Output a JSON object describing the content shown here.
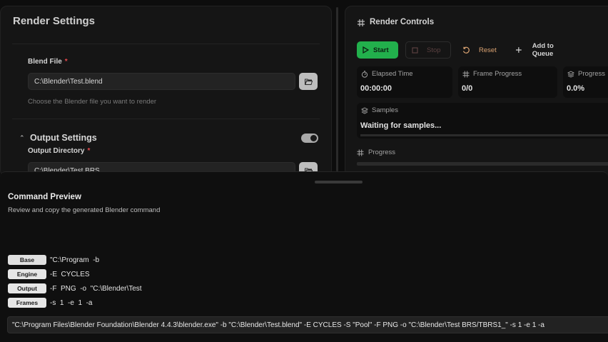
{
  "render_settings": {
    "title": "Render Settings",
    "blend_file": {
      "label": "Blend File",
      "required_mark": "*",
      "value": "C:\\Blender\\Test.blend",
      "helper": "Choose the Blender file you want to render"
    },
    "output_settings": {
      "title": "Output Settings",
      "enabled": true,
      "output_directory": {
        "label": "Output Directory",
        "required_mark": "*",
        "value": "C:\\Blender\\Test BRS"
      }
    }
  },
  "render_controls": {
    "title": "Render Controls",
    "buttons": {
      "start": "Start",
      "stop": "Stop",
      "reset": "Reset",
      "add_to_queue": "Add to Queue"
    },
    "stats": {
      "elapsed_label": "Elapsed Time",
      "elapsed_value": "00:00:00",
      "frame_progress_label": "Frame Progress",
      "frame_progress_value": "0/0",
      "progress_label": "Progress",
      "progress_value": "0.0%"
    },
    "samples": {
      "label": "Samples",
      "status": "Waiting for samples..."
    },
    "progress_section_label": "Progress",
    "progress_fraction": 0,
    "colors": {
      "start": "#22b04c",
      "reset": "#d9a271",
      "stop": "#5a4040"
    }
  },
  "command_preview": {
    "title": "Command Preview",
    "description": "Review and copy the generated Blender command",
    "rows": [
      {
        "badge": "Base",
        "value": "\"C:\\Program  -b"
      },
      {
        "badge": "Engine",
        "value": "-E  CYCLES"
      },
      {
        "badge": "Output",
        "value": "-F  PNG  -o  \"C:\\Blender\\Test"
      },
      {
        "badge": "Frames",
        "value": "-s  1  -e  1  -a"
      }
    ],
    "full_command": "\"C:\\Program Files\\Blender Foundation\\Blender 4.4.3\\blender.exe\" -b \"C:\\Blender\\Test.blend\" -E CYCLES -S \"Pool\" -F PNG -o \"C:\\Blender\\Test BRS/TBRS1_\" -s 1 -e 1 -a"
  }
}
